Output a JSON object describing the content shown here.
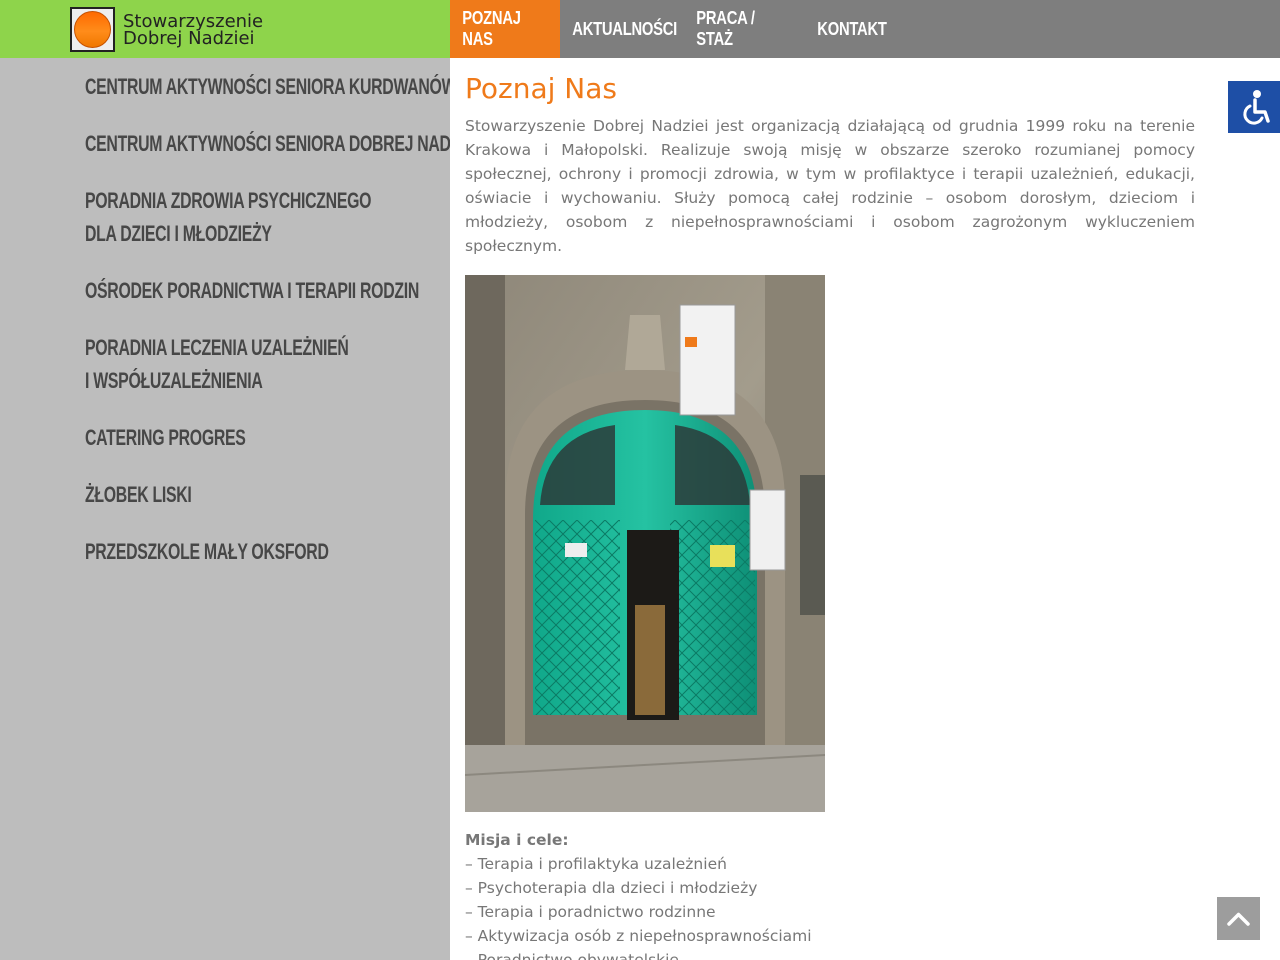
{
  "header": {
    "logo_line1": "Stowarzyszenie",
    "logo_line2": "Dobrej Nadziei",
    "colors": {
      "green": "#8ed44b",
      "nav_bg": "#7e7e7e",
      "accent": "#ef7a1a"
    }
  },
  "nav": {
    "items": [
      {
        "label": "Poznaj nas",
        "active": true
      },
      {
        "label": "Aktualności",
        "active": false
      },
      {
        "label": "Praca / Staż",
        "active": false
      },
      {
        "label": "Kontakt",
        "active": false
      }
    ]
  },
  "sidebar": {
    "items": [
      {
        "line1": "Centrum Aktywności Seniora Kurdwanów",
        "line2": ""
      },
      {
        "line1": "Centrum Aktywności Seniora Dobrej Nadziei",
        "line2": ""
      },
      {
        "line1": "Poradnia Zdrowia Psychicznego",
        "line2": "dla Dzieci i Młodzieży"
      },
      {
        "line1": "Ośrodek Poradnictwa i Terapii Rodzin",
        "line2": ""
      },
      {
        "line1": "Poradnia Leczenia Uzależnień",
        "line2": "i Współuzależnienia"
      },
      {
        "line1": "Catering Progres",
        "line2": ""
      },
      {
        "line1": "Żłobek Liski",
        "line2": ""
      },
      {
        "line1": "Przedszkole Mały Oksford",
        "line2": ""
      }
    ]
  },
  "main": {
    "title": "Poznaj Nas",
    "intro": "Stowarzyszenie Dobrej Nadziei jest organizacją działającą od grudnia 1999 roku na terenie Krakowa i Małopolski. Realizuje swoją misję w obszarze szeroko rozumianej pomocy społecznej, ochrony i promocji zdrowia, w tym w profilaktyce i terapii uzależnień, edukacji, oświacie i wychowaniu. Służy pomocą całej rodzinie – osobom dorosłym, dzieciom i młodzieży, osobom z niepełnosprawnościami i osobom zagrożonym wykluczeniem społecznym.",
    "mission_title": "Misja i cele:",
    "mission_items": [
      "– Terapia i profilaktyka uzależnień",
      "– Psychoterapia dla dzieci i młodzieży",
      "– Terapia i poradnictwo rodzinne",
      "– Aktywizacja osób z niepełnosprawnościami",
      "– Poradnictwo obywatelskie"
    ]
  },
  "icons": {
    "accessibility": "accessibility-icon",
    "back_to_top": "chevron-up-icon"
  }
}
